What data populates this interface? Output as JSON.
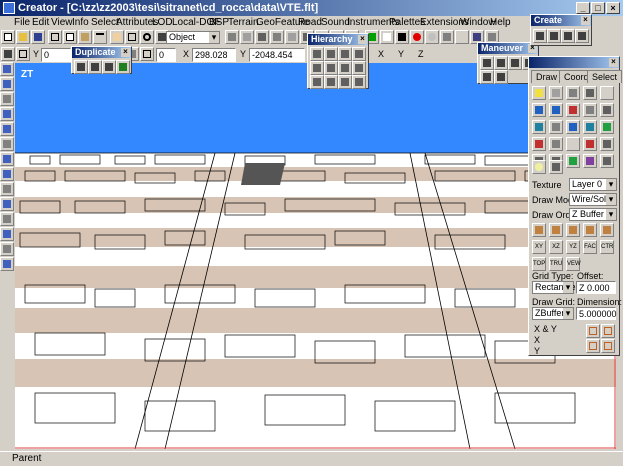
{
  "window": {
    "title": "Creator - [C:\\zz\\zz2003\\tesi\\sitranet\\cd_rocca\\data\\VTE.flt]"
  },
  "menu": [
    "File",
    "Edit",
    "View",
    "Info",
    "Select",
    "Attributes",
    "LOD",
    "Local-DOF",
    "BSP",
    "Terrain",
    "GeoFeature",
    "Road",
    "Sound",
    "Instruments",
    "Palettes",
    "Extensions",
    "Window",
    "Help"
  ],
  "toolbar": {
    "select_mode": "Object",
    "y_label": "Y",
    "y_value": "0",
    "value_0": "0",
    "x_label": "X",
    "x_value": "298.028",
    "y2_label": "Y",
    "y2_value": "-2048.454",
    "axis_x": "X",
    "axis_y": "Y",
    "axis_z": "Z"
  },
  "palettes": {
    "duplicate": "Duplicate",
    "hierarchy": "Hierarchy",
    "maneuver": "Maneuver",
    "create": "Create"
  },
  "viewport": {
    "label": "ZT"
  },
  "attr_panel": {
    "tabs": [
      "Draw",
      "Coord",
      "Select"
    ],
    "texture_label": "Texture",
    "texture_value": "Layer 0",
    "draw_mode_label": "Draw Mode",
    "draw_mode_value": "Wire/Solid",
    "draw_order_label": "Draw Order",
    "draw_order_value": "Z Buffer",
    "view_buttons": [
      "XY",
      "XZ",
      "YZ",
      "FAC",
      "CTR",
      "TOP",
      "TRU",
      "VEW"
    ],
    "grid_type_label": "Grid Type:",
    "grid_type_value": "Rectangle",
    "offset_label": "Offset:",
    "offset_value": "Z 0.000",
    "draw_grid_label": "Draw Grid:",
    "draw_grid_value": "ZBuffer",
    "dimension_label": "Dimension:",
    "dimension_value": "5.000000",
    "radio_xy": "X & Y",
    "radio_x": "X",
    "radio_y": "Y"
  },
  "status": {
    "text": "Parent"
  }
}
